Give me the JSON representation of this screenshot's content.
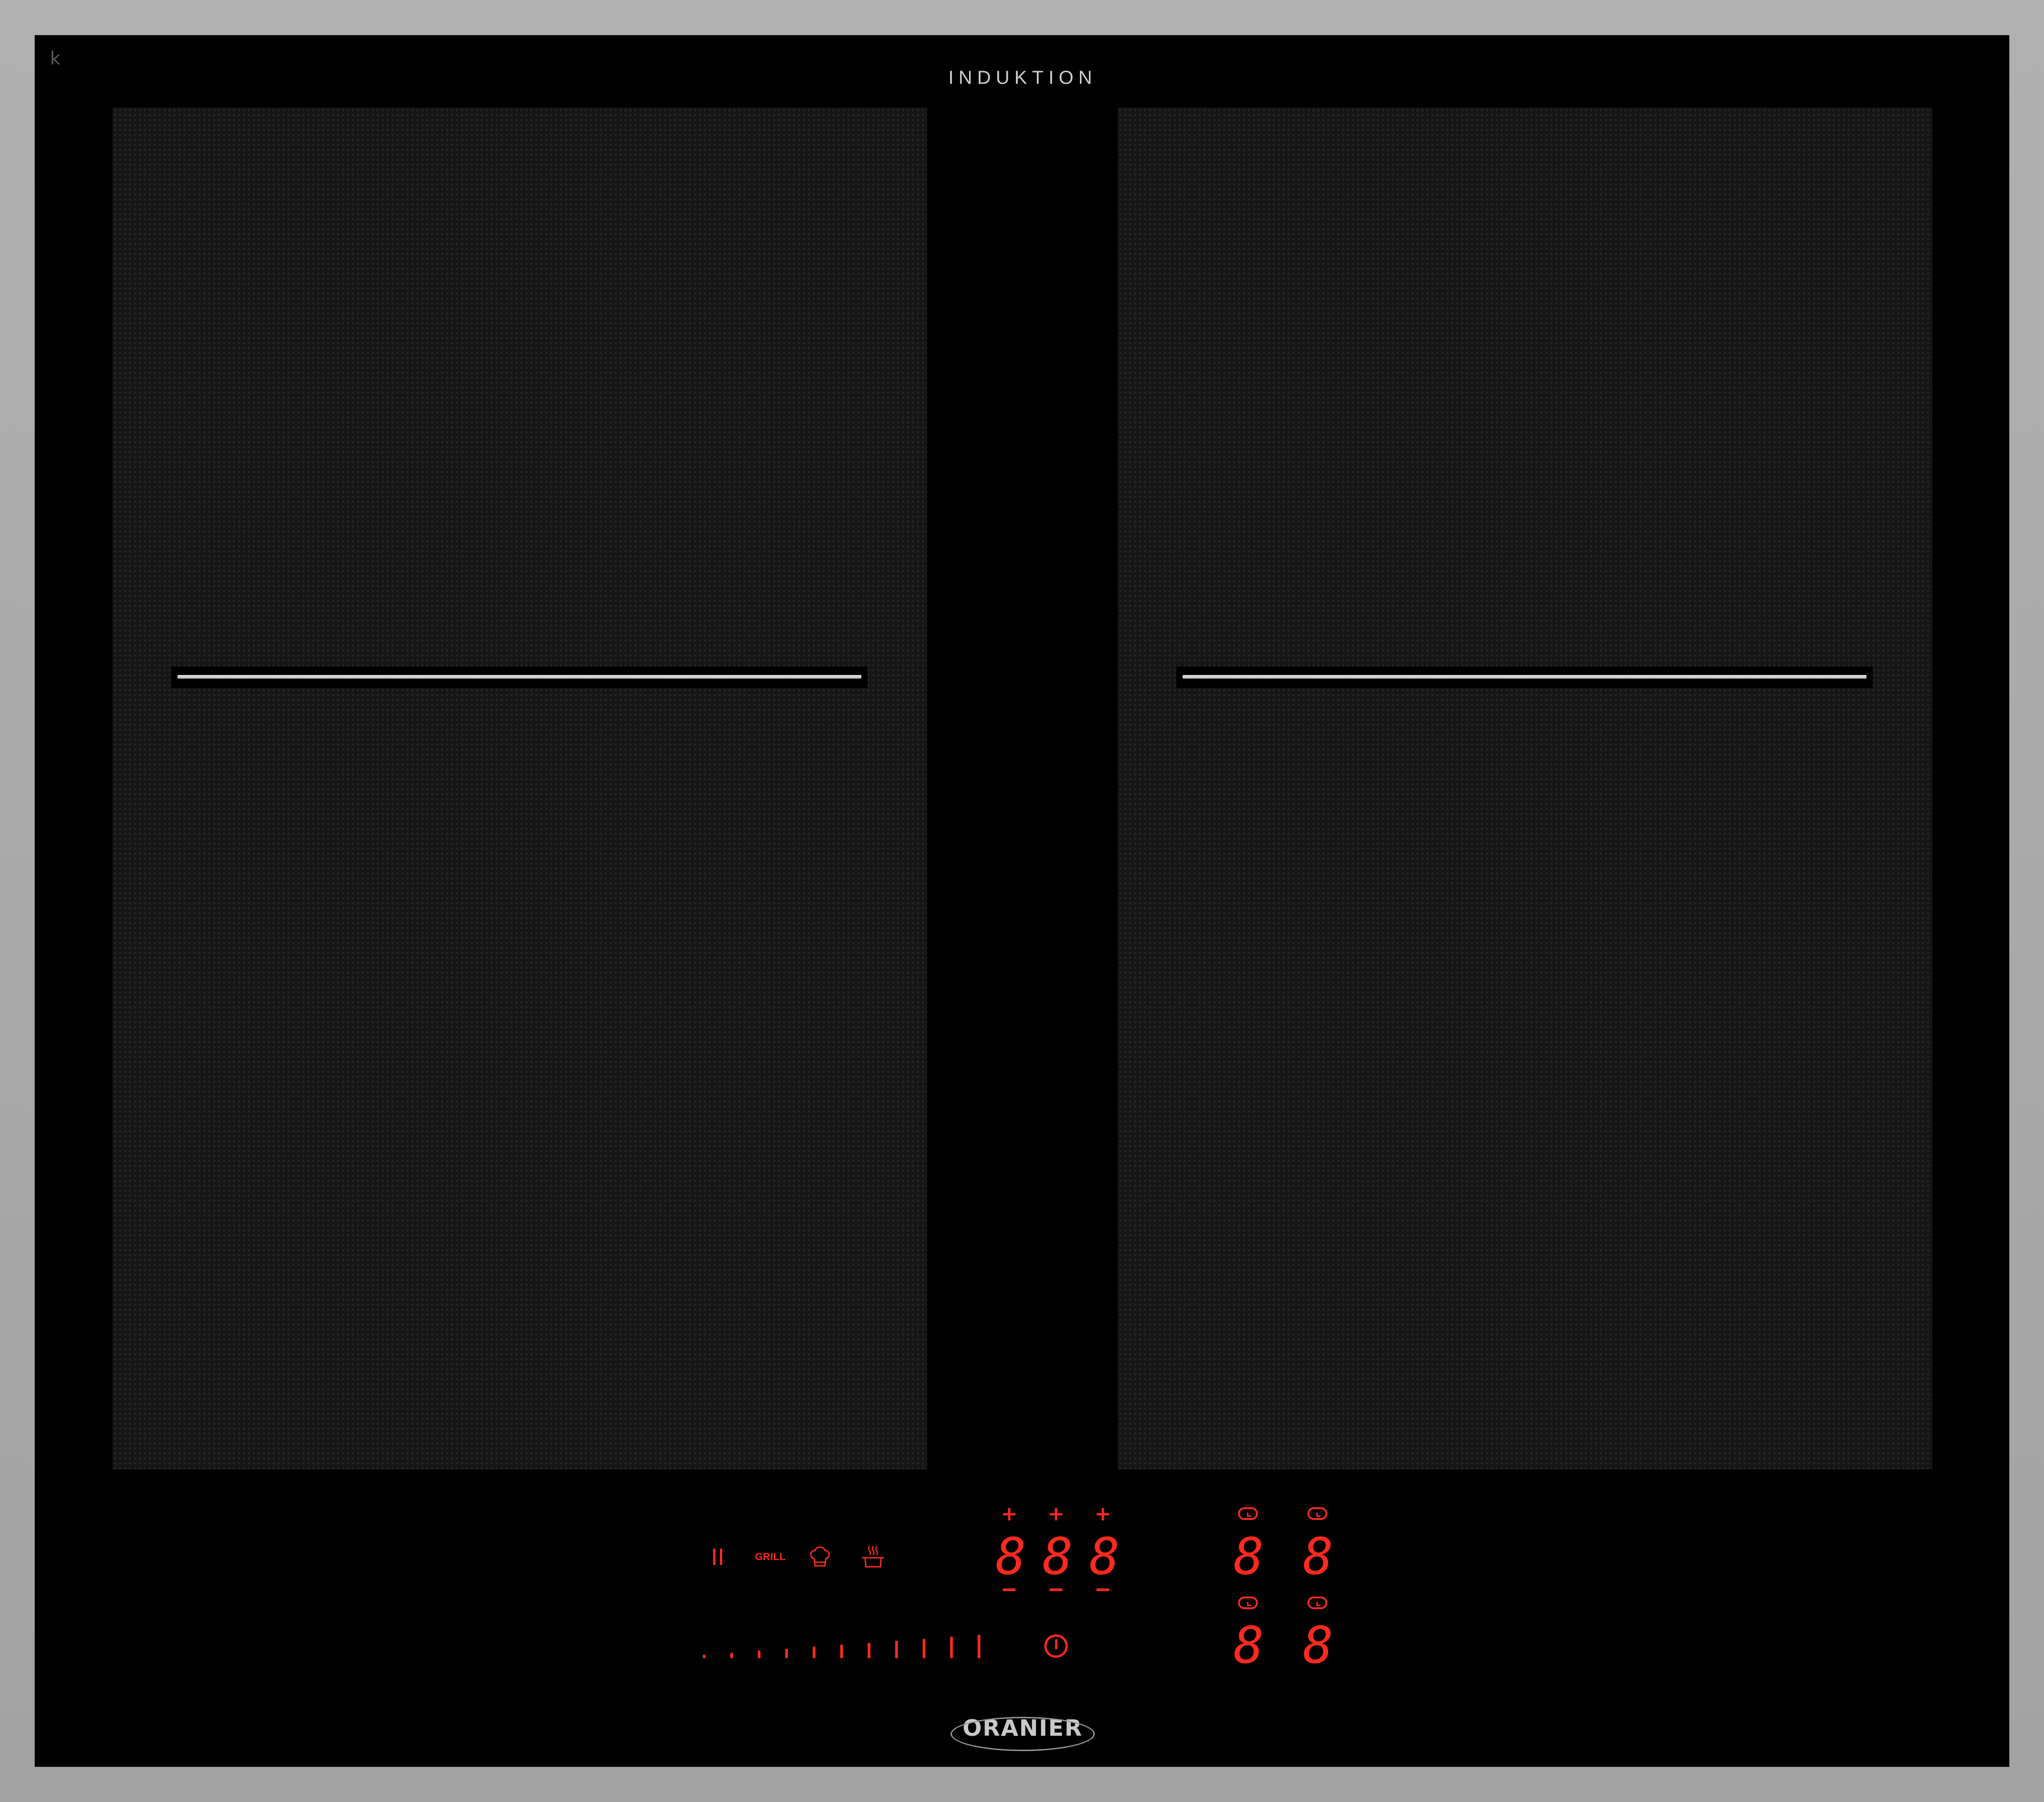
{
  "brand": {
    "top_label": "INDUKTION",
    "bottom_logo": "ORANIER",
    "corner_mark": "k"
  },
  "colors": {
    "frame": "#a7a7a7",
    "glass": "#000000",
    "zone": "#151515",
    "display_red": "#ff2a1f",
    "bridge_line": "#d0d0d0"
  },
  "zones": [
    {
      "name": "left-flex-zone"
    },
    {
      "name": "right-flex-zone"
    }
  ],
  "controls": {
    "pause_icon": "pause-icon",
    "grill_label": "GRILL",
    "chef_icon": "chef-hat-icon",
    "pot_icon": "steaming-pot-icon",
    "power_icon": "power-icon",
    "plus_symbol": "+",
    "power_displays": [
      "8",
      "8",
      "8"
    ],
    "timer_displays": [
      "8",
      "8",
      "8",
      "8"
    ],
    "slider_levels": 11
  }
}
